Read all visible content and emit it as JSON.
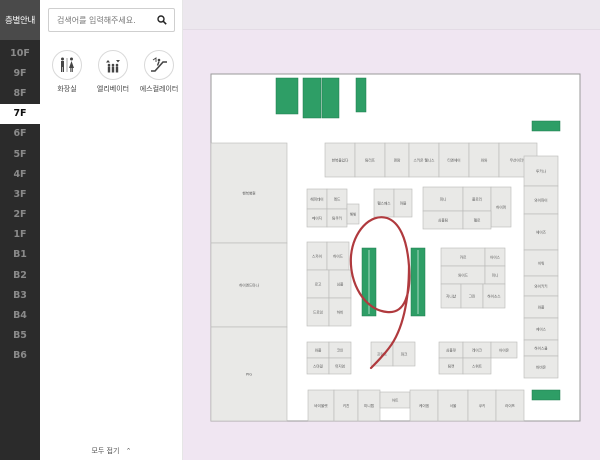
{
  "floor_guide": {
    "title": "층별안내",
    "floors": [
      "10F",
      "9F",
      "8F",
      "7F",
      "6F",
      "5F",
      "4F",
      "3F",
      "2F",
      "1F",
      "B1",
      "B2",
      "B3",
      "B4",
      "B5",
      "B6"
    ],
    "active_floor": "7F"
  },
  "search": {
    "placeholder": "검색어를 입력해주세요."
  },
  "facilities": [
    {
      "label": "화장실",
      "icon": "restroom-icon"
    },
    {
      "label": "엘리베이터",
      "icon": "elevator-icon"
    },
    {
      "label": "에스컬레이터",
      "icon": "escalator-icon"
    }
  ],
  "collapse_label": "모두 접기",
  "colors": {
    "rail": "#2b2b2b",
    "rail_title": "#4a4a4a",
    "map_background": "#f0e6f2",
    "store": "#e9e9e7",
    "store_border": "#b8b8b6",
    "facility_green": "#2e9e66",
    "annotation": "#b03a3e"
  },
  "map": {
    "stores": [
      "행복병원",
      "하이엔드마나",
      "PIG",
      "한복을입다",
      "팀리프",
      "덴맘",
      "스키온 웰니스",
      "티엔에이",
      "와와",
      "무선이더넷",
      "투키나",
      "와이파이",
      "에이즈",
      "쉬워",
      "와이키키",
      "와플",
      "케이스",
      "하이스쿨",
      "바비온",
      "해피데이",
      "레드",
      "메이지",
      "팀쿠키",
      "해빛",
      "헬스패스",
      "마블",
      "피니",
      "플로리",
      "하이퍼",
      "심플팀",
      "헬로",
      "스카이",
      "하이드",
      "로고",
      "심플",
      "드로잉",
      "하비",
      "카르",
      "아이스",
      "와이드",
      "미니",
      "지니샵",
      "그린",
      "하이소스",
      "와플",
      "코인",
      "스마일",
      "뮤지엄",
      "프린트",
      "파크",
      "심플핏",
      "레이크",
      "아이온",
      "팀캣",
      "스위트",
      "바이올렛",
      "키친",
      "미니랩",
      "아트",
      "케이엠",
      "서울",
      "쿠키",
      "라이프",
      "두부",
      "가든",
      "에어",
      "케이",
      "메이트",
      "하이원"
    ]
  }
}
